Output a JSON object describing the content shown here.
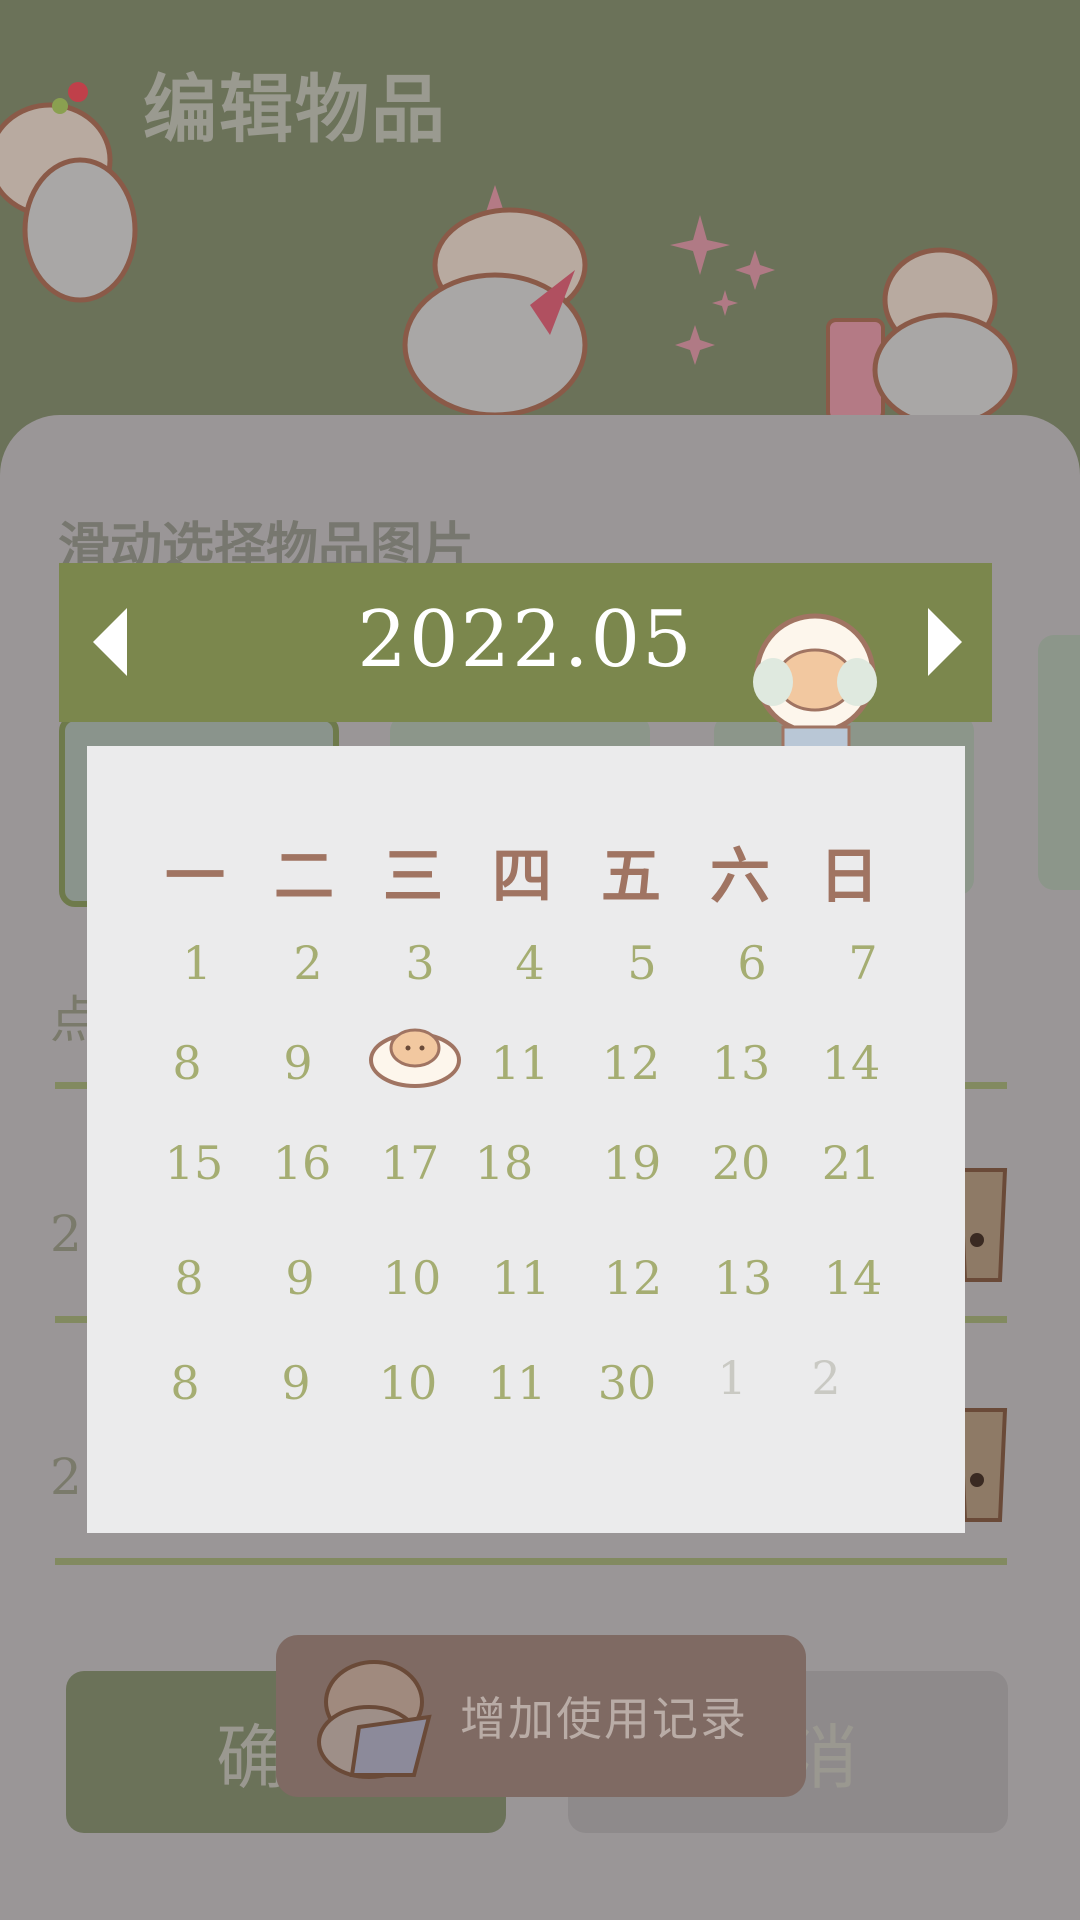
{
  "page": {
    "title": "编辑物品"
  },
  "sheet": {
    "section_title": "滑动选择物品图片",
    "side_label_1": "点",
    "side_label_2": "2",
    "side_label_3": "2"
  },
  "buttons": {
    "confirm": "确定",
    "cancel": "取消"
  },
  "toast": {
    "text": "增加使用记录"
  },
  "calendar": {
    "month": "2022.05",
    "weekdays": [
      "一",
      "二",
      "三",
      "四",
      "五",
      "六",
      "日"
    ],
    "weeks": [
      [
        "1",
        "2",
        "3",
        "4",
        "5",
        "6",
        "7"
      ],
      [
        "8",
        "9",
        "",
        "11",
        "12",
        "13",
        "14"
      ],
      [
        "15",
        "16",
        "17",
        "18",
        "19",
        "20",
        "21"
      ],
      [
        "8",
        "9",
        "10",
        "11",
        "12",
        "13",
        "14"
      ],
      [
        "8",
        "9",
        "10",
        "11",
        "30",
        "1",
        "2"
      ]
    ],
    "selected_day_marker": "hamster-icon",
    "muted_days": "next month: 1, 2"
  },
  "colors": {
    "accent_green": "#7b874d",
    "weekday_brown": "#a07462",
    "day_green": "#a5ad72"
  }
}
